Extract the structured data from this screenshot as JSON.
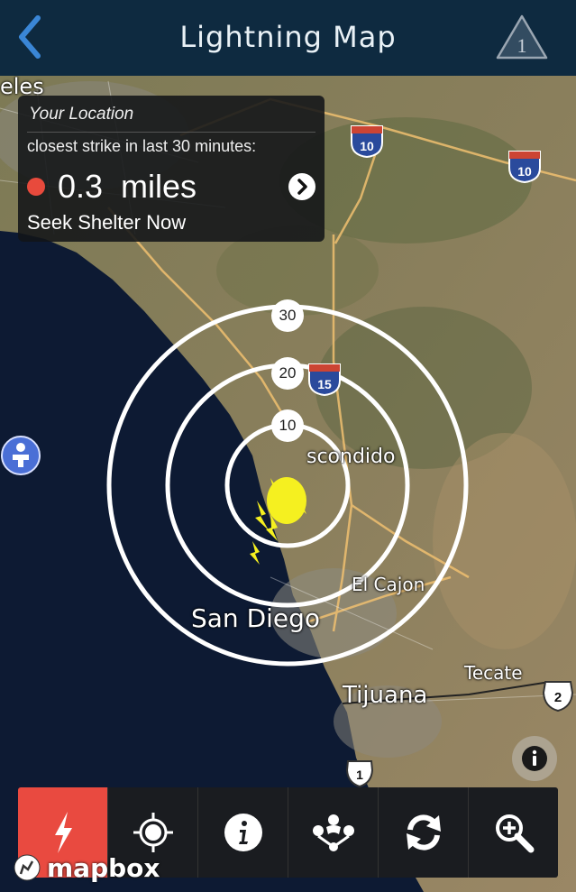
{
  "header": {
    "title": "Lightning Map",
    "alert_count": "1"
  },
  "info_box": {
    "heading": "Your Location",
    "subtitle": "closest strike in last 30 minutes:",
    "distance_value": "0.3",
    "distance_unit": "miles",
    "advice": "Seek Shelter Now"
  },
  "rings": [
    "30",
    "20",
    "10"
  ],
  "places": [
    "San Diego",
    "El Cajon",
    "Tijuana",
    "Tecate",
    "scondido",
    "eles"
  ],
  "highways": [
    "10",
    "10",
    "15",
    "2",
    "1"
  ],
  "attribution": "mapbox",
  "toolbar": [
    "lightning-icon",
    "locate-icon",
    "info-icon",
    "network-icon",
    "refresh-icon",
    "zoom-icon"
  ],
  "colors": {
    "header": "#0e2a40",
    "accent": "#3a86d6",
    "active": "#e94a40",
    "strike_dot": "#e84a3c",
    "lightning": "#f5f020"
  }
}
